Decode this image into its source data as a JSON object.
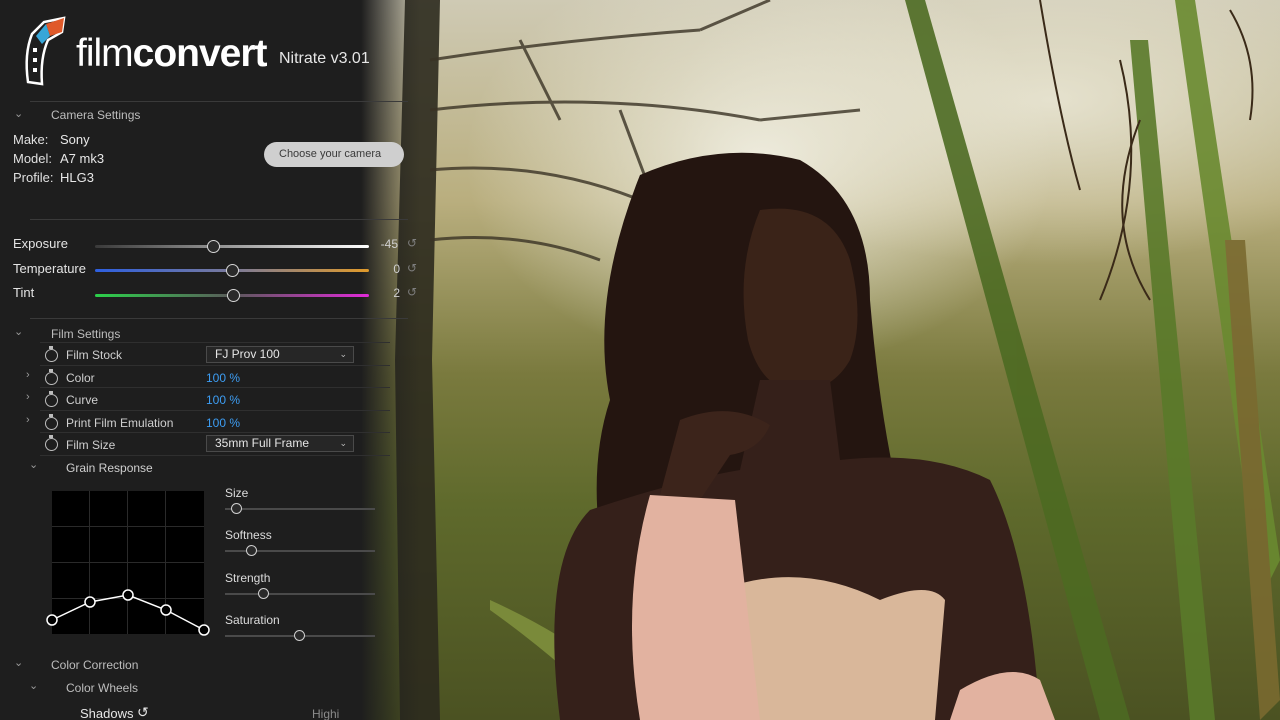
{
  "app": {
    "brand_light": "film",
    "brand_bold": "convert",
    "version": "Nitrate v3.01"
  },
  "camera": {
    "section_title": "Camera Settings",
    "make_label": "Make:",
    "make_value": "Sony",
    "model_label": "Model:",
    "model_value": "A7 mk3",
    "profile_label": "Profile:",
    "profile_value": "HLG3",
    "choose_button": "Choose your camera"
  },
  "adjust": {
    "exposure": {
      "label": "Exposure",
      "value": "-45",
      "position": 0.43
    },
    "temperature": {
      "label": "Temperature",
      "value": "0",
      "position": 0.5
    },
    "tint": {
      "label": "Tint",
      "value": "2",
      "position": 0.505
    }
  },
  "film": {
    "section_title": "Film Settings",
    "film_stock_label": "Film Stock",
    "film_stock_value": "FJ Prov 100",
    "color_label": "Color",
    "color_value": "100 %",
    "curve_label": "Curve",
    "curve_value": "100 %",
    "print_label": "Print Film Emulation",
    "print_value": "100 %",
    "size_label": "Film Size",
    "size_value": "35mm Full Frame"
  },
  "grain": {
    "section_title": "Grain Response",
    "size": {
      "label": "Size",
      "position": 0.08
    },
    "softness": {
      "label": "Softness",
      "position": 0.18
    },
    "strength": {
      "label": "Strength",
      "position": 0.26
    },
    "saturation": {
      "label": "Saturation",
      "position": 0.5
    },
    "curve_points": [
      0.1,
      0.28,
      0.35,
      0.2,
      0.0
    ]
  },
  "color_correction": {
    "section_title": "Color Correction",
    "wheels_title": "Color Wheels",
    "shadows_label": "Shadows",
    "highlights_label": "Highi"
  },
  "colors": {
    "accent": "#3d9df3",
    "panel": "#1e1e1e"
  }
}
